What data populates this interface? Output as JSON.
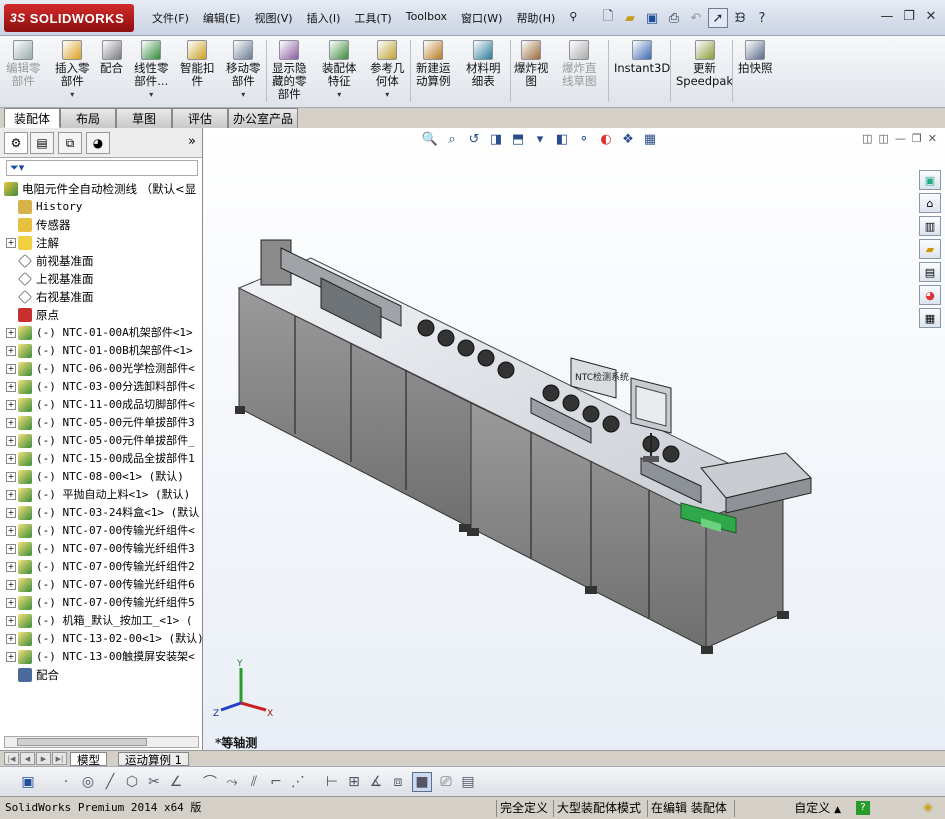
{
  "app": {
    "logo": "SOLIDWORKS",
    "logo_prefix": "3S"
  },
  "menu": [
    "文件(F)",
    "编辑(E)",
    "视图(V)",
    "插入(I)",
    "工具(T)",
    "Toolbox",
    "窗口(W)",
    "帮助(H)"
  ],
  "ribbon": {
    "buttons": [
      {
        "label": "编辑零\n部件",
        "disabled": true
      },
      {
        "label": "插入零\n部件",
        "disabled": false
      },
      {
        "label": "配合",
        "disabled": false
      },
      {
        "label": "线性零\n部件...",
        "disabled": false
      },
      {
        "label": "智能扣\n件",
        "disabled": false
      },
      {
        "label": "移动零\n部件",
        "disabled": false
      },
      {
        "label": "显示隐\n藏的零\n部件",
        "disabled": false
      },
      {
        "label": "装配体\n特征",
        "disabled": false
      },
      {
        "label": "参考几\n何体",
        "disabled": false
      },
      {
        "label": "新建运\n动算例",
        "disabled": false
      },
      {
        "label": "材料明\n细表",
        "disabled": false
      },
      {
        "label": "爆炸视\n图",
        "disabled": false
      },
      {
        "label": "爆炸直\n线草图",
        "disabled": true
      },
      {
        "label": "Instant3D",
        "disabled": false
      },
      {
        "label": "更新\nSpeedpak",
        "disabled": false
      },
      {
        "label": "拍快照",
        "disabled": false
      }
    ]
  },
  "tabs": [
    "装配体",
    "布局",
    "草图",
    "评估",
    "办公室产品"
  ],
  "tree": {
    "root": "电阻元件全自动检测线 （默认<显",
    "items": [
      {
        "label": "History",
        "expand": false,
        "mono": true
      },
      {
        "label": "传感器",
        "expand": false,
        "mono": false
      },
      {
        "label": "注解",
        "expand": true,
        "mono": false
      },
      {
        "label": "前视基准面",
        "expand": false,
        "mono": false
      },
      {
        "label": "上视基准面",
        "expand": false,
        "mono": false
      },
      {
        "label": "右视基准面",
        "expand": false,
        "mono": false
      },
      {
        "label": "原点",
        "expand": false,
        "mono": false
      },
      {
        "label": "(-) NTC-01-00A机架部件<1>",
        "expand": true,
        "mono": true
      },
      {
        "label": "(-) NTC-01-00B机架部件<1>",
        "expand": true,
        "mono": true
      },
      {
        "label": "(-) NTC-06-00光学检测部件<",
        "expand": true,
        "mono": true
      },
      {
        "label": "(-) NTC-03-00分选卸料部件<",
        "expand": true,
        "mono": true
      },
      {
        "label": "(-) NTC-11-00成品切脚部件<",
        "expand": true,
        "mono": true
      },
      {
        "label": "(-) NTC-05-00元件单拔部件3",
        "expand": true,
        "mono": true
      },
      {
        "label": "(-) NTC-05-00元件单拔部件_",
        "expand": true,
        "mono": true
      },
      {
        "label": "(-) NTC-15-00成品全拔部件1",
        "expand": true,
        "mono": true
      },
      {
        "label": "(-) NTC-08-00<1> (默认)",
        "expand": true,
        "mono": true
      },
      {
        "label": "(-) 平抛自动上料<1> (默认)",
        "expand": true,
        "mono": true
      },
      {
        "label": "(-) NTC-03-24料盒<1> (默认",
        "expand": true,
        "mono": true
      },
      {
        "label": "(-) NTC-07-00传输光纤组件<",
        "expand": true,
        "mono": true
      },
      {
        "label": "(-) NTC-07-00传输光纤组件3",
        "expand": true,
        "mono": true
      },
      {
        "label": "(-) NTC-07-00传输光纤组件2",
        "expand": true,
        "mono": true
      },
      {
        "label": "(-) NTC-07-00传输光纤组件6",
        "expand": true,
        "mono": true
      },
      {
        "label": "(-) NTC-07-00传输光纤组件5",
        "expand": true,
        "mono": true
      },
      {
        "label": "(-) 机箱_默认_按加工_<1> (",
        "expand": true,
        "mono": true
      },
      {
        "label": "(-) NTC-13-02-00<1> (默认)",
        "expand": true,
        "mono": true
      },
      {
        "label": "(-) NTC-13-00触摸屏安装架<",
        "expand": true,
        "mono": true
      },
      {
        "label": "配合",
        "expand": false,
        "mono": false
      }
    ]
  },
  "viewport": {
    "view_label": "*等轴测",
    "triad": {
      "x": "X",
      "y": "Y",
      "z": "Z"
    },
    "screen_text": "NTC检测系统"
  },
  "bottom_tabs": [
    "模型",
    "运动算例 1"
  ],
  "status": {
    "product": "SolidWorks Premium 2014 x64 版",
    "state1": "完全定义",
    "state2": "大型装配体模式",
    "state3": "在编辑 装配体",
    "units": "自定义"
  },
  "colors": {
    "accent": "#c41e1e",
    "frame": "#6e6e6e",
    "panel": "#8c8c8c"
  }
}
